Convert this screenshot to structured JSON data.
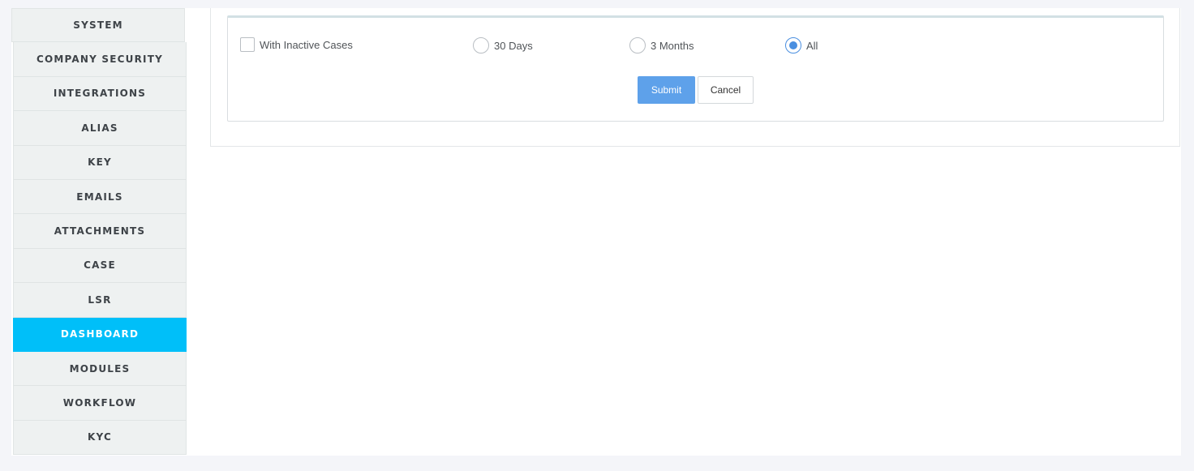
{
  "sidebar": {
    "items": [
      {
        "label": "SYSTEM"
      },
      {
        "label": "COMPANY SECURITY"
      },
      {
        "label": "INTEGRATIONS"
      },
      {
        "label": "ALIAS"
      },
      {
        "label": "KEY"
      },
      {
        "label": "EMAILS"
      },
      {
        "label": "ATTACHMENTS"
      },
      {
        "label": "CASE"
      },
      {
        "label": "LSR"
      },
      {
        "label": "DASHBOARD",
        "active": true
      },
      {
        "label": "MODULES"
      },
      {
        "label": "WORKFLOW"
      },
      {
        "label": "KYC"
      }
    ]
  },
  "filters": {
    "inactive_checkbox": {
      "label": "With Inactive Cases",
      "checked": false
    },
    "range": {
      "options": [
        {
          "label": "30 Days",
          "selected": false
        },
        {
          "label": "3 Months",
          "selected": false
        },
        {
          "label": "All",
          "selected": true
        }
      ]
    }
  },
  "actions": {
    "submit_label": "Submit",
    "cancel_label": "Cancel"
  },
  "colors": {
    "active_sidebar": "#00bff9",
    "submit_button": "#5ea1ea",
    "radio_selected": "#4a8fe0"
  }
}
